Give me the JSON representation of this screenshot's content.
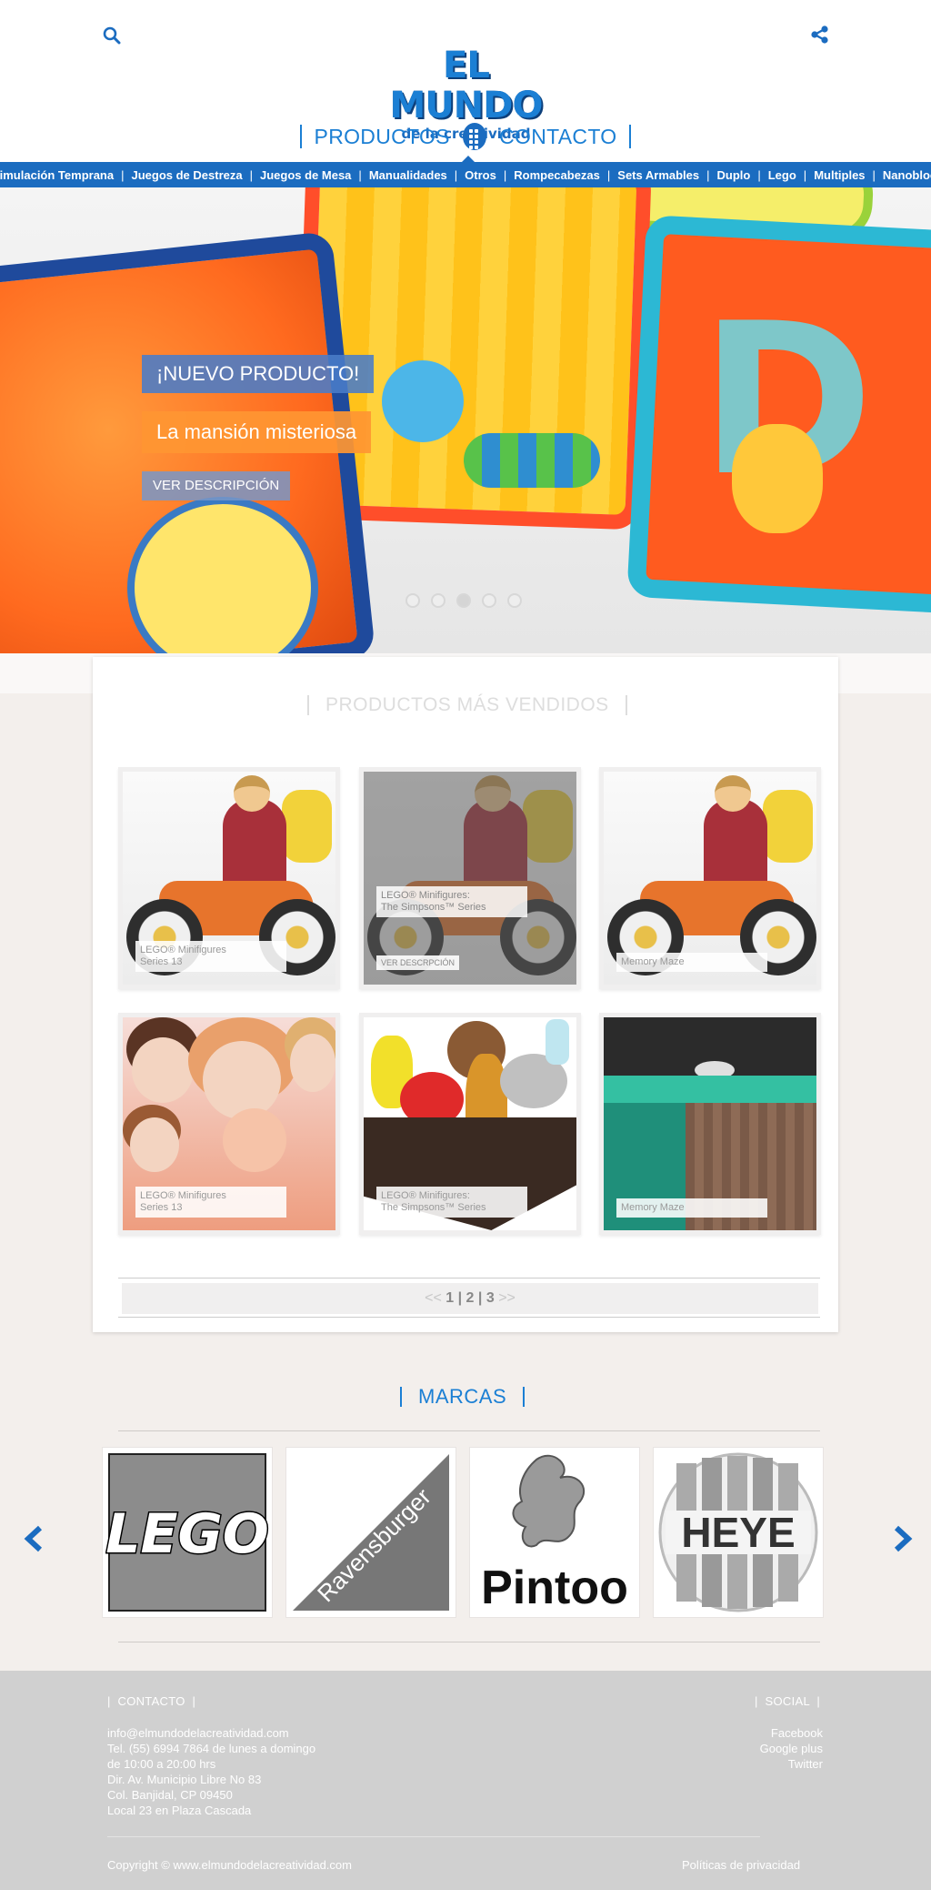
{
  "header": {
    "logo": {
      "main": "EL MUNDO",
      "sub": "de la creatividad"
    },
    "nav": {
      "products": "PRODUCTOS",
      "contact": "CONTACTO"
    },
    "categories": [
      "Estimulación Temprana",
      "Juegos de Destreza",
      "Juegos de Mesa",
      "Manualidades",
      "Otros",
      "Rompecabezas",
      "Sets Armables",
      "Duplo",
      "Lego",
      "Multiples",
      "Nanoblocks"
    ],
    "icons": {
      "search": "search-icon",
      "share": "share-icon",
      "grid": "grid-icon"
    }
  },
  "hero": {
    "badge": "¡NUEVO PRODUCTO!",
    "title": "La mansión misteriosa",
    "button": "VER DESCRIPCIÓN",
    "slides": 5,
    "active_slide": 3
  },
  "best_sellers": {
    "title": "PRODUCTOS MÁS VENDIDOS",
    "products": [
      {
        "label_line1": "LEGO® Minifigures",
        "label_line2": "Series 13"
      },
      {
        "label_line1": "LEGO® Minifigures:",
        "label_line2": "The Simpsons™ Series",
        "button": "VER DESCRPCIÓN"
      },
      {
        "label_line1": "Memory Maze",
        "label_line2": ""
      },
      {
        "label_line1": "LEGO® Minifigures",
        "label_line2": "Series 13"
      },
      {
        "label_line1": "LEGO® Minifigures:",
        "label_line2": "The Simpsons™ Series"
      },
      {
        "label_line1": "Memory Maze",
        "label_line2": ""
      }
    ],
    "pager": {
      "prev": "<<",
      "pages": [
        "1",
        "2",
        "3"
      ],
      "next": ">>"
    }
  },
  "brands": {
    "title": "MARCAS",
    "items": [
      "LEGO",
      "Ravensburger",
      "Pintoo",
      "HEYE"
    ]
  },
  "footer": {
    "contact_title": "CONTACTO",
    "contact_lines": [
      "info@elmundodelacreatividad.com",
      "Tel. (55) 6994 7864 de lunes a domingo",
      "de 10:00 a 20:00 hrs",
      "Dir. Av. Municipio Libre No 83",
      "Col. Banjidal, CP 09450",
      "Local 23 en Plaza Cascada"
    ],
    "social_title": "SOCIAL",
    "social_links": [
      "Facebook",
      "Google plus",
      "Twitter"
    ],
    "copyright": "Copyright © www.elmundodelacreatividad.com",
    "privacy": "Políticas de privacidad"
  },
  "colors": {
    "brand_blue": "#1b6cc0",
    "accent_orange": "#ff9632",
    "footer_grey": "#d0d0d0"
  }
}
